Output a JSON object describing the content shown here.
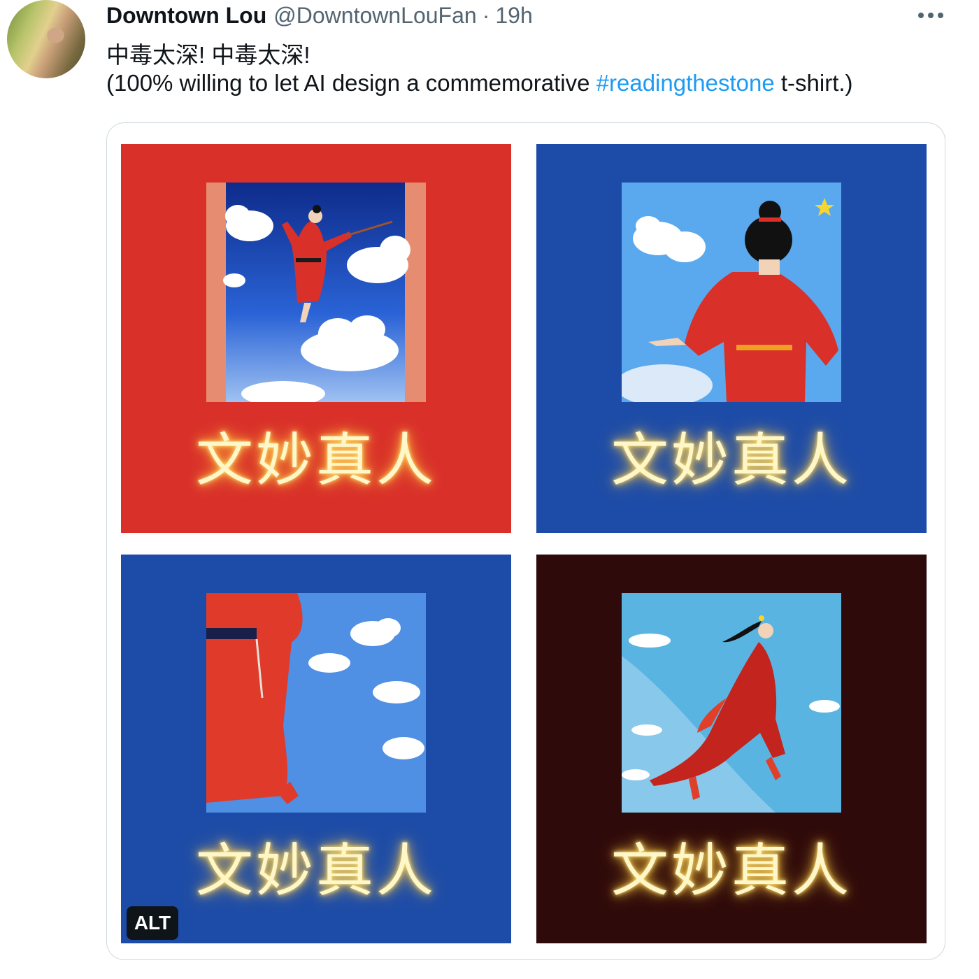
{
  "tweet": {
    "author_name": "Downtown Lou",
    "author_handle": "@DowntownLouFan",
    "separator": "·",
    "time": "19h",
    "more_icon": "more-horizontal-icon",
    "text_line1": "中毒太深! 中毒太深!",
    "text_line2_before": "(100% willing to let AI design a commemorative ",
    "hashtag": "#readingthestone",
    "text_line2_after": " t-shirt.)"
  },
  "media": {
    "alt_label": "ALT",
    "images": [
      {
        "caption": "文妙真人",
        "background": "#d9302a"
      },
      {
        "caption": "文妙真人",
        "background": "#1d4ca8"
      },
      {
        "caption": "文妙真人",
        "background": "#1d4ca8"
      },
      {
        "caption": "文妙真人",
        "background": "#2e0a0a"
      }
    ]
  },
  "colors": {
    "hashtag": "#1d9bf0",
    "secondary_text": "#536471",
    "caption_glow": "#ffe27a"
  }
}
